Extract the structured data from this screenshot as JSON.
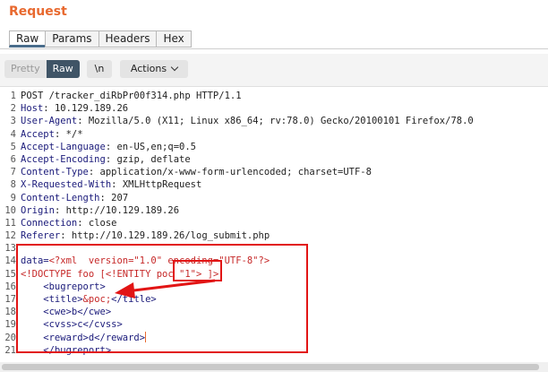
{
  "panel": {
    "title": "Request"
  },
  "tabs": [
    "Raw",
    "Params",
    "Headers",
    "Hex"
  ],
  "toolbar": {
    "pretty_label": "Pretty",
    "raw_label": "Raw",
    "newline_label": "\\n",
    "actions_label": "Actions"
  },
  "request_line": "POST /tracker_diRbPr00f314.php HTTP/1.1",
  "headers": [
    {
      "key": "Host",
      "value": "10.129.189.26"
    },
    {
      "key": "User-Agent",
      "value": "Mozilla/5.0 (X11; Linux x86_64; rv:78.0) Gecko/20100101 Firefox/78.0"
    },
    {
      "key": "Accept",
      "value": "*/*"
    },
    {
      "key": "Accept-Language",
      "value": "en-US,en;q=0.5"
    },
    {
      "key": "Accept-Encoding",
      "value": "gzip, deflate"
    },
    {
      "key": "Content-Type",
      "value": "application/x-www-form-urlencoded; charset=UTF-8"
    },
    {
      "key": "X-Requested-With",
      "value": "XMLHttpRequest"
    },
    {
      "key": "Content-Length",
      "value": "207"
    },
    {
      "key": "Origin",
      "value": "http://10.129.189.26"
    },
    {
      "key": "Connection",
      "value": "close"
    },
    {
      "key": "Referer",
      "value": "http://10.129.189.26/log_submit.php"
    }
  ],
  "body": {
    "param": "data=",
    "xml_decl": "<?xml  version=\"1.0\" encoding=\"UTF-8\"?>",
    "doctype_pre": "<!DOCTYPE foo [<!ENTITY ",
    "doctype_entity": "poc \"1\">",
    "doctype_post": " ]>",
    "bugreport_open": "    <bugreport>",
    "title_open": "    <title>",
    "title_entity": "&poc;",
    "title_close": "</title>",
    "cwe": "    <cwe>b</cwe>",
    "cvss": "    <cvss>c</cvss>",
    "reward": "    <reward>d</reward>",
    "bugreport_close": "    </bugreport>"
  },
  "line_numbers": [
    "1",
    "2",
    "3",
    "4",
    "5",
    "6",
    "7",
    "8",
    "9",
    "10",
    "11",
    "12",
    "13",
    "14",
    "15",
    "16",
    "17",
    "18",
    "19",
    "20",
    "21"
  ],
  "colors": {
    "accent": "#e8692f",
    "highlight": "#e21515",
    "active_seg": "#3f5466"
  }
}
